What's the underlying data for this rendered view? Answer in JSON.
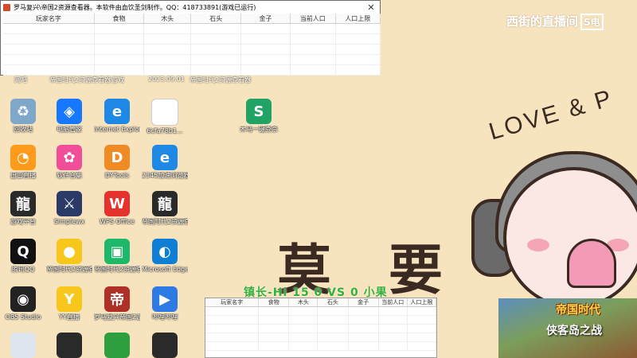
{
  "window": {
    "title": "罗马复兴\\帝国2资源查看器。本软件由血饮圣剑制作。QQ：418733891(游戏已运行)",
    "close": "✕",
    "columns": [
      "玩家名字",
      "食物",
      "木头",
      "石头",
      "金子",
      "当前人口",
      "人口上限"
    ]
  },
  "window2": {
    "columns": [
      "玩家名字",
      "食物",
      "木头",
      "石头",
      "金子",
      "当前人口",
      "人口上限"
    ]
  },
  "overlay_score": "镇长-Hi 15 0  VS  0  小果",
  "watermark": {
    "text": "西街的直播间",
    "logo": "S电"
  },
  "wallpaper": {
    "love": "LOVE & P",
    "char1": "莫",
    "char2": "要"
  },
  "thumbnail": {
    "title": "帝国时代",
    "subtitle": "侠客岛之战"
  },
  "desktop_icons": [
    {
      "label": "回收站",
      "icon": "recycle-bin-icon",
      "color": "#7fa7c9",
      "glyph": "♻"
    },
    {
      "label": "电脑管家",
      "icon": "pc-manager-icon",
      "color": "#1677ff",
      "glyph": "◈"
    },
    {
      "label": "Internet Explorer",
      "icon": "ie-icon",
      "color": "#1e88e5",
      "glyph": "e"
    },
    {
      "label": "6cfa78b1...",
      "icon": "file-icon",
      "color": "#ffffff",
      "glyph": " "
    },
    {
      "label": "木马一键查杀",
      "icon": "excel-icon",
      "color": "#21a366",
      "glyph": "S"
    },
    {
      "label": "迅雷直播",
      "icon": "live-icon",
      "color": "#ff9b1a",
      "glyph": "◔"
    },
    {
      "label": "软件合集",
      "icon": "apps-icon",
      "color": "#f04e98",
      "glyph": "✿"
    },
    {
      "label": "DYTools",
      "icon": "tool-icon",
      "color": "#f08a24",
      "glyph": "D"
    },
    {
      "label": "2345加速浏览器",
      "icon": "browser-icon",
      "color": "#1e88e5",
      "glyph": "e"
    },
    {
      "label": "游戏平台",
      "icon": "dragon-icon",
      "color": "#2a2a2a",
      "glyph": "龍"
    },
    {
      "label": "Simplewx",
      "icon": "sword-icon",
      "color": "#2b3a67",
      "glyph": "⚔"
    },
    {
      "label": "WPS Office",
      "icon": "wps-icon",
      "color": "#e5322d",
      "glyph": "W"
    },
    {
      "label": "帝国时代2资源查看",
      "icon": "dragon-icon-2",
      "color": "#2a2a2a",
      "glyph": "龍"
    },
    {
      "label": "腾讯QQ",
      "icon": "qq-icon",
      "color": "#111111",
      "glyph": "🐧"
    },
    {
      "label": "帝国时代2资源查看",
      "icon": "bird-icon",
      "color": "#f7c71c",
      "glyph": "●"
    },
    {
      "label": "帝国时代2资源查看",
      "icon": "android-icon",
      "color": "#1eb86a",
      "glyph": "▣"
    },
    {
      "label": "Microsoft Edge",
      "icon": "edge-icon",
      "color": "#0f7fd6",
      "glyph": "◐"
    },
    {
      "label": "OBS Studio",
      "icon": "obs-icon",
      "color": "#222222",
      "glyph": "◉"
    },
    {
      "label": "YY直播",
      "icon": "yy-icon",
      "color": "#f7c71c",
      "glyph": "Y"
    },
    {
      "label": "罗马复兴帝国2游戏",
      "icon": "game-icon",
      "color": "#b03028",
      "glyph": "帝"
    },
    {
      "label": "哔哩哔哩",
      "icon": "media-icon",
      "color": "#2c7be5",
      "glyph": "▶"
    }
  ],
  "top_row_labels": [
    "网吧",
    "帝国时代2资源查看器",
    "游戏",
    "2023.09.01",
    "帝国时代2资源查看器"
  ]
}
